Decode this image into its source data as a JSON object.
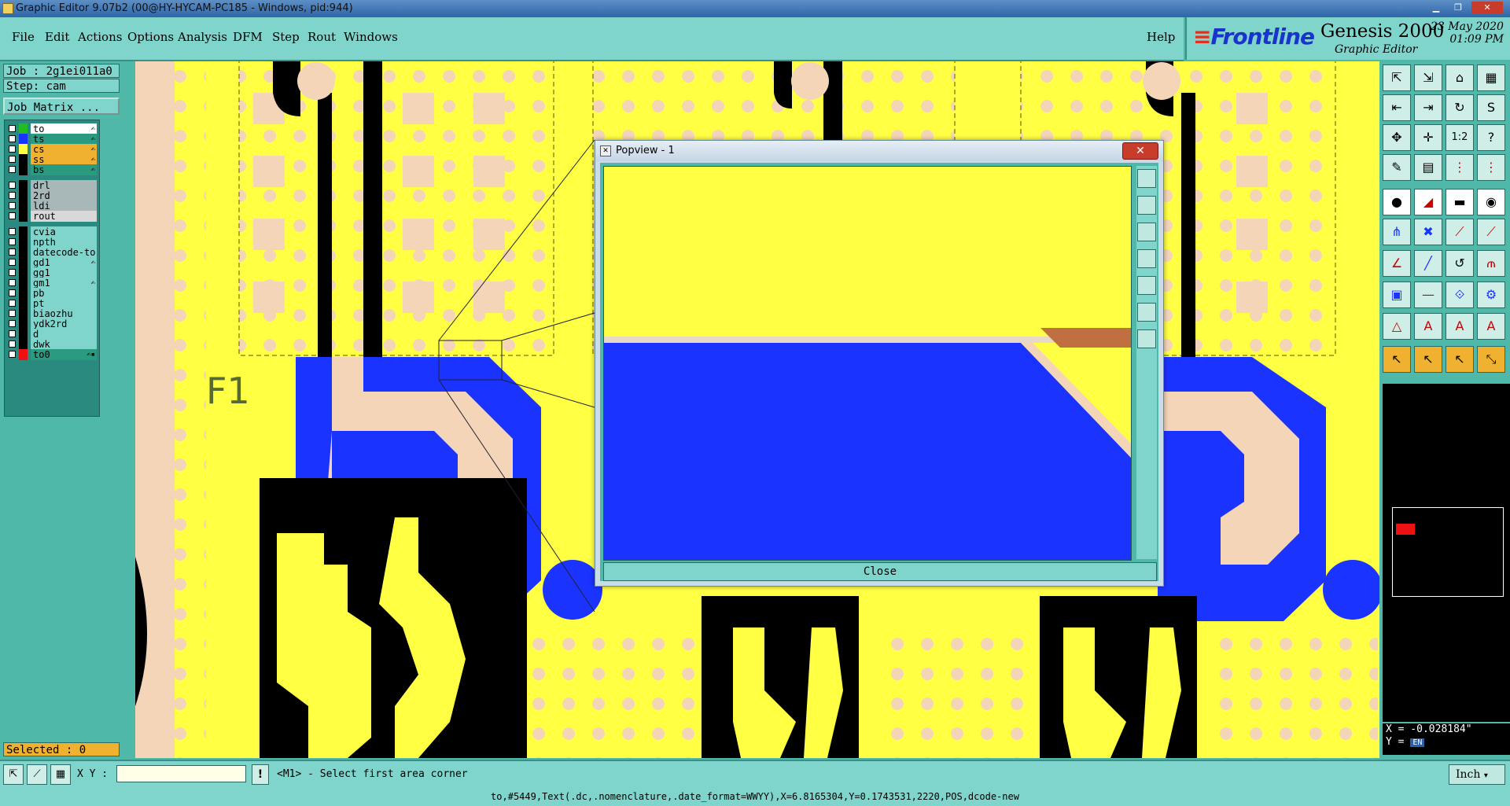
{
  "window": {
    "title": "Graphic Editor 9.07b2 (00@HY-HYCAM-PC185 - Windows, pid:944)"
  },
  "menu": {
    "items": [
      "File",
      "Edit",
      "Actions",
      "Options",
      "Analysis",
      "DFM",
      "Step",
      "Rout",
      "Windows"
    ],
    "help": "Help"
  },
  "branding": {
    "logo": "Frontline",
    "product": "Genesis 2000",
    "subtitle": "Graphic Editor",
    "date": "23 May 2020",
    "time": "01:09 PM"
  },
  "left_panel": {
    "job": "Job : 2g1ei011a0",
    "step": "Step: cam",
    "job_matrix_button": "Job Matrix ...",
    "layers": [
      {
        "name": "to",
        "swatch": "#22bb22",
        "bg": "#ffffff",
        "flag": "✍"
      },
      {
        "name": "ts",
        "swatch": "#1a33ff",
        "bg": "#2a9a80",
        "flag": "✍"
      },
      {
        "name": "cs",
        "swatch": "#ffff44",
        "bg": "#f0b030",
        "flag": "✍"
      },
      {
        "name": "ss",
        "swatch": "#000000",
        "bg": "#f0b030",
        "flag": "✍"
      },
      {
        "name": "bs",
        "swatch": "#000000",
        "bg": "#2a9a80",
        "flag": "✍"
      },
      {
        "name": "drl",
        "swatch": "#000000",
        "bg": "#a8b8b8",
        "flag": ""
      },
      {
        "name": "2rd",
        "swatch": "#000000",
        "bg": "#a8b8b8",
        "flag": ""
      },
      {
        "name": "ldi",
        "swatch": "#000000",
        "bg": "#a8b8b8",
        "flag": ""
      },
      {
        "name": "rout",
        "swatch": "#000000",
        "bg": "#d8d8d8",
        "flag": ""
      },
      {
        "name": "cvia",
        "swatch": "#000000",
        "bg": "#7fd4cc",
        "flag": ""
      },
      {
        "name": "npth",
        "swatch": "#000000",
        "bg": "#7fd4cc",
        "flag": ""
      },
      {
        "name": "datecode-to",
        "swatch": "#000000",
        "bg": "#7fd4cc",
        "flag": ""
      },
      {
        "name": "gd1",
        "swatch": "#000000",
        "bg": "#7fd4cc",
        "flag": "✍"
      },
      {
        "name": "gg1",
        "swatch": "#000000",
        "bg": "#7fd4cc",
        "flag": ""
      },
      {
        "name": "gm1",
        "swatch": "#000000",
        "bg": "#7fd4cc",
        "flag": "✍"
      },
      {
        "name": "pb",
        "swatch": "#000000",
        "bg": "#7fd4cc",
        "flag": ""
      },
      {
        "name": "pt",
        "swatch": "#000000",
        "bg": "#7fd4cc",
        "flag": ""
      },
      {
        "name": "biaozhu",
        "swatch": "#000000",
        "bg": "#7fd4cc",
        "flag": ""
      },
      {
        "name": "ydk2rd",
        "swatch": "#000000",
        "bg": "#7fd4cc",
        "flag": ""
      },
      {
        "name": "d",
        "swatch": "#000000",
        "bg": "#7fd4cc",
        "flag": ""
      },
      {
        "name": "dwk",
        "swatch": "#000000",
        "bg": "#7fd4cc",
        "flag": ""
      },
      {
        "name": "to0",
        "swatch": "#ee1111",
        "bg": "#2a9a80",
        "flag": "✍▪"
      }
    ],
    "selected": "Selected : 0"
  },
  "canvas": {
    "label": "F1"
  },
  "popview": {
    "title": "Popview - 1",
    "close_label": "Close"
  },
  "right_panel": {
    "coord_x": "X = -0.028184\"",
    "coord_y": "Y =",
    "ime": "EN"
  },
  "bottom": {
    "xy_label": "X Y :",
    "xy_value": "",
    "prompt": "<M1> - Select first area corner",
    "units": "Inch"
  },
  "status": {
    "text": "to,#5449,Text(.dc,.nomenclature,.date_format=WWYY),X=6.8165304,Y=0.1743531,2220,POS,dcode-new"
  }
}
